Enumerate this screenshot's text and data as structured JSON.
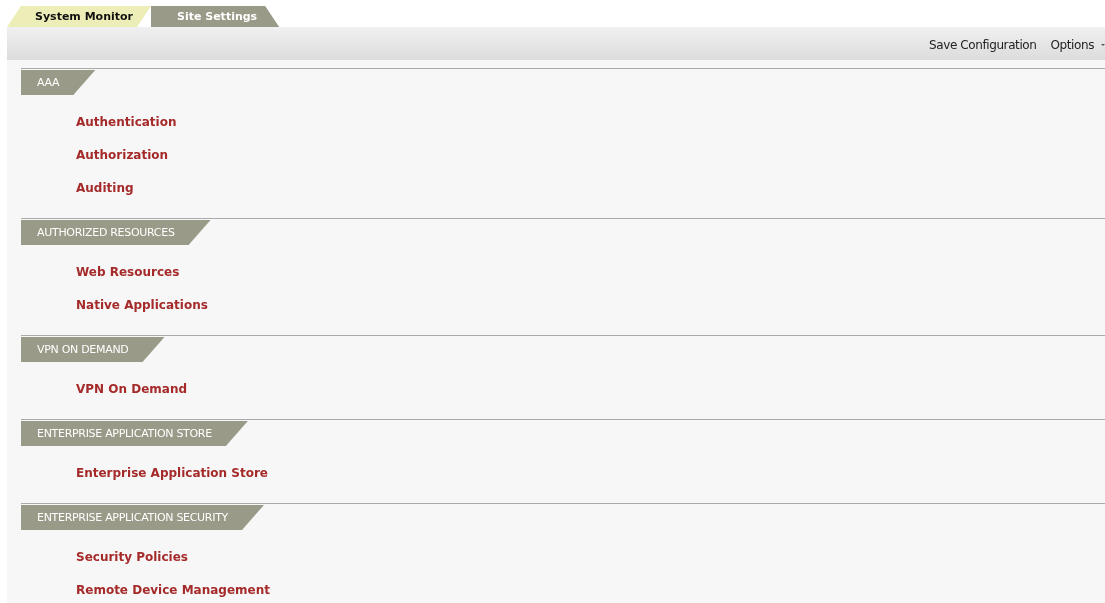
{
  "tabs": [
    {
      "label": "System Monitor",
      "selected": true
    },
    {
      "label": "Site Settings",
      "selected": false
    }
  ],
  "toolbar": {
    "save": "Save Configuration",
    "options": "Options"
  },
  "sections": [
    {
      "title": "AAA",
      "links": [
        "Authentication",
        "Authorization",
        "Auditing"
      ]
    },
    {
      "title": "AUTHORIZED RESOURCES",
      "links": [
        "Web Resources",
        "Native Applications"
      ]
    },
    {
      "title": "VPN ON DEMAND",
      "links": [
        "VPN On Demand"
      ]
    },
    {
      "title": "ENTERPRISE APPLICATION STORE",
      "links": [
        "Enterprise Application Store"
      ]
    },
    {
      "title": "ENTERPRISE APPLICATION SECURITY",
      "links": [
        "Security Policies",
        "Remote Device Management"
      ]
    }
  ]
}
